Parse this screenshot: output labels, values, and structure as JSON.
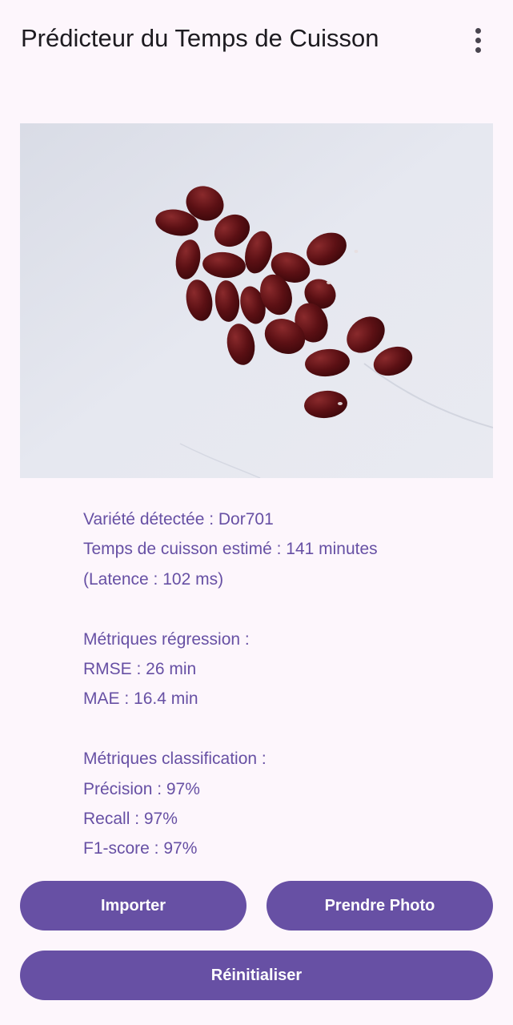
{
  "app_bar": {
    "title": "Prédicteur du Temps de Cuisson",
    "menu_icon": "more-vert-icon"
  },
  "image": {
    "subject": "beans-photo"
  },
  "results": {
    "variety": "Variété détectée : Dor701",
    "cooking_time": "Temps de cuisson estimé : 141 minutes",
    "latency": "(Latence : 102 ms)",
    "regression_header": "Métriques régression :",
    "rmse": "RMSE : 26 min",
    "mae": "MAE : 16.4 min",
    "classification_header": "Métriques classification :",
    "precision": "Précision : 97%",
    "recall": "Recall : 97%",
    "f1": "F1-score : 97%"
  },
  "buttons": {
    "import": "Importer",
    "take_photo": "Prendre Photo",
    "reset": "Réinitialiser"
  },
  "colors": {
    "primary": "#6750a4",
    "background": "#fdf6fc",
    "photo_background": "#e3e6ef",
    "bean": "#5a0f12"
  }
}
